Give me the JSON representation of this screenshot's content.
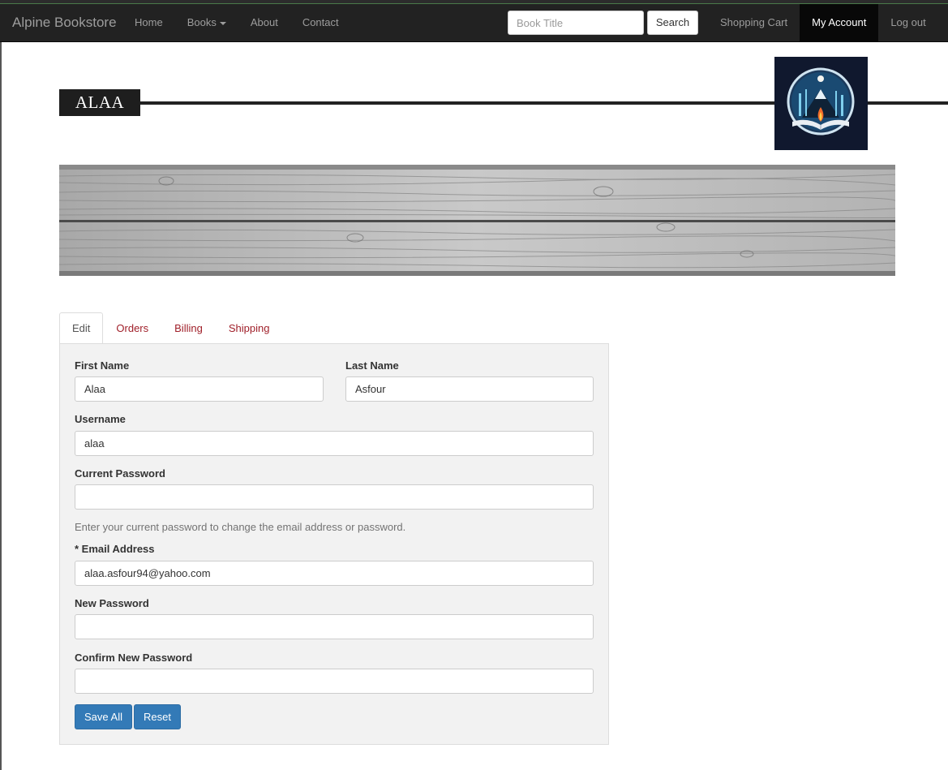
{
  "navbar": {
    "brand": "Alpine Bookstore",
    "items": [
      {
        "label": "Home"
      },
      {
        "label": "Books"
      },
      {
        "label": "About"
      },
      {
        "label": "Contact"
      }
    ],
    "search": {
      "placeholder": "Book Title",
      "button": "Search"
    },
    "right_items": [
      {
        "label": "Shopping Cart"
      },
      {
        "label": "My Account"
      },
      {
        "label": "Log out"
      }
    ]
  },
  "header": {
    "name": "ALAA"
  },
  "tabs": [
    {
      "label": "Edit"
    },
    {
      "label": "Orders"
    },
    {
      "label": "Billing"
    },
    {
      "label": "Shipping"
    }
  ],
  "form": {
    "first_name": {
      "label": "First Name",
      "value": "Alaa"
    },
    "last_name": {
      "label": "Last Name",
      "value": "Asfour"
    },
    "username": {
      "label": "Username",
      "value": "alaa"
    },
    "current_password": {
      "label": "Current Password",
      "value": ""
    },
    "password_help": "Enter your current password to change the email address or password.",
    "email": {
      "label": "* Email Address",
      "value": "alaa.asfour94@yahoo.com"
    },
    "new_password": {
      "label": "New Password",
      "value": ""
    },
    "confirm_password": {
      "label": "Confirm New Password",
      "value": ""
    },
    "save_label": "Save All",
    "reset_label": "Reset"
  },
  "colors": {
    "navbar_bg": "#222222",
    "tab_link": "#a0202a",
    "primary_button": "#337ab7"
  }
}
